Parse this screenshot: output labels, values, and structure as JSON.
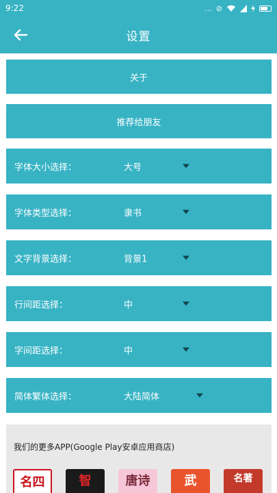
{
  "status_bar": {
    "time": "9:22",
    "signal_text": "...",
    "mute": "⊘"
  },
  "app_bar": {
    "title": "设置"
  },
  "buttons": {
    "about": "关于",
    "recommend": "推荐给朋友"
  },
  "settings": [
    {
      "label": "字体大小选择：",
      "value": "大号"
    },
    {
      "label": "字体类型选择：",
      "value": "隶书"
    },
    {
      "label": "文字背景选择：",
      "value": "背景1"
    },
    {
      "label": "行间距选择：",
      "value": "中"
    },
    {
      "label": "字间距选择：",
      "value": "中"
    },
    {
      "label": "简体繁体选择：",
      "value": "大陆简体"
    }
  ],
  "more_apps": {
    "title": "我们的更多APP(Google Play安卓应用商店)",
    "apps": [
      {
        "glyph": "名四",
        "bg": "#ffffff",
        "fg": "#c8141c",
        "icon": "famous-four-icon"
      },
      {
        "glyph": "智",
        "bg": "#1a1a1a",
        "fg": "#e3262a",
        "icon": "wisdom-icon"
      },
      {
        "glyph": "唐诗",
        "bg": "#f7c6d8",
        "fg": "#7a2a3a",
        "icon": "tang-poetry-icon"
      },
      {
        "glyph": "武",
        "bg": "#e9542c",
        "fg": "#ffffff",
        "icon": "martial-icon"
      },
      {
        "glyph": "名著",
        "bg": "#c33a2b",
        "fg": "#ffffff",
        "icon": "masterpiece-book-icon"
      }
    ]
  },
  "colors": {
    "primary": "#37b3c4",
    "caret": "#12444c",
    "panel": "#e9e8e8"
  }
}
